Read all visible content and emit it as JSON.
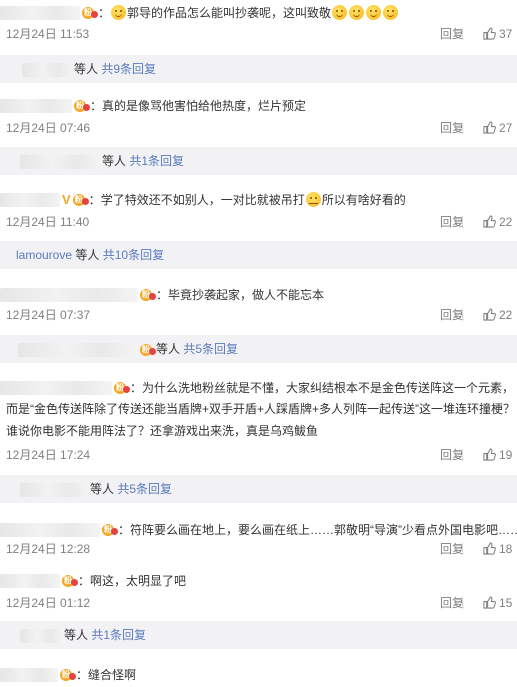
{
  "reply_label": "回复",
  "suffix": "等人",
  "comments": [
    {
      "text": "郭导的作品怎么能叫抄袭呢，这叫致敬",
      "time": "12月24日 11:53",
      "likes": "37",
      "sub": {
        "more": "共9条回复"
      }
    },
    {
      "text": "真的是像骂他害怕给他热度，烂片预定",
      "time": "12月24日 07:46",
      "likes": "27",
      "sub": {
        "more": "共1条回复"
      }
    },
    {
      "text_a": "学了特效还不如别人，一对比就被吊打",
      "text_b": "所以有啥好看的",
      "time": "12月24日 11:40",
      "likes": "22",
      "sub": {
        "name": "lamourove",
        "more": "共10条回复"
      }
    },
    {
      "text": "毕竟抄袭起家，做人不能忘本",
      "time": "12月24日 07:37",
      "likes": "22",
      "sub": {
        "more": "共5条回复"
      }
    },
    {
      "line1": "为什么洗地粉丝就是不懂，大家纠结根本不是金色传送阵这一个元素，",
      "line2": "而是“金色传送阵除了传送还能当盾牌+双手开盾+人踩盾牌+多人列阵一起传送”这一堆连环撞梗？",
      "line3": "谁说你电影不能用阵法了？还拿游戏出来洗，真是乌鸡鲅鱼",
      "time": "12月24日 17:24",
      "likes": "19",
      "sub": {
        "more": "共5条回复"
      }
    },
    {
      "text": "符阵要么画在地上，要么画在纸上……郭敬明“导演”少看点外国电影吧……",
      "time": "12月24日 12:28",
      "likes": "18"
    },
    {
      "text": "啊这，太明显了吧",
      "time": "12月24日 01:12",
      "likes": "15",
      "sub": {
        "more": "共1条回复"
      }
    },
    {
      "text": "缝合怪啊"
    }
  ],
  "icons": {
    "thumb": "thumbs-up-icon",
    "badge": "fan-badge-icon",
    "verified": "verified-v-icon",
    "smile": "smile-emoji-icon",
    "sweat": "sweat-emoji-icon"
  }
}
